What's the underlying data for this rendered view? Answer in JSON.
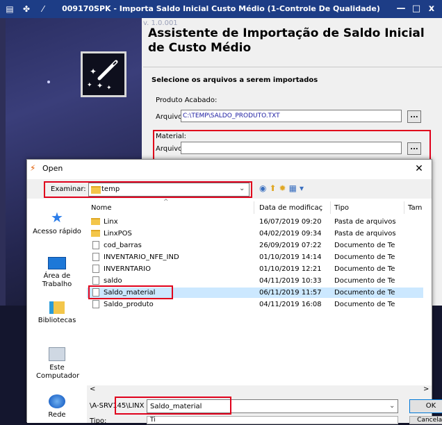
{
  "app": {
    "title": "009170SPK - Importa Saldo Inicial Custo Médio (1-Controle De Qualidade)",
    "window_controls": {
      "minimize": "—",
      "maximize": "□",
      "close": "x"
    },
    "version": "v. 1.0.001",
    "wizard_title": "Assistente de Importação de Saldo Inicial de Custo Médio",
    "select_files_label": "Selecione os arquivos a serem importados",
    "produto_acabado": {
      "group_label": "Produto Acabado:",
      "field_label": "Arquivo:",
      "value": "C:\\TEMP\\SALDO_PRODUTO.TXT",
      "browse_label": "..."
    },
    "material": {
      "group_label": "Material:",
      "field_label": "Arquivo:",
      "value": "",
      "browse_label": "..."
    }
  },
  "dialog": {
    "title": "Open",
    "close_label": "✕",
    "examine_label": "Examinar:",
    "current_folder": "temp",
    "places": [
      {
        "label": "Acesso rápido",
        "icon": "star-icon"
      },
      {
        "label": "Área de Trabalho",
        "icon": "desktop-icon"
      },
      {
        "label": "Bibliotecas",
        "icon": "libraries-icon"
      },
      {
        "label": "Este Computador",
        "icon": "computer-icon"
      },
      {
        "label": "Rede",
        "icon": "network-icon"
      }
    ],
    "columns": [
      "Nome",
      "Data de modificaç",
      "Tipo",
      "Tam"
    ],
    "files": [
      {
        "name": "Linx",
        "date": "16/07/2019 09:20",
        "type": "Pasta de arquivos",
        "kind": "folder"
      },
      {
        "name": "LinxPOS",
        "date": "04/02/2019 09:34",
        "type": "Pasta de arquivos",
        "kind": "folder"
      },
      {
        "name": "cod_barras",
        "date": "26/09/2019 07:22",
        "type": "Documento de Te",
        "kind": "doc"
      },
      {
        "name": "INVENTARIO_NFE_IND",
        "date": "01/10/2019 14:14",
        "type": "Documento de Te",
        "kind": "doc"
      },
      {
        "name": "INVERNTARIO",
        "date": "01/10/2019 12:21",
        "type": "Documento de Te",
        "kind": "doc"
      },
      {
        "name": "saldo",
        "date": "04/11/2019 10:33",
        "type": "Documento de Te",
        "kind": "doc"
      },
      {
        "name": "Saldo_material",
        "date": "06/11/2019 11:57",
        "type": "Documento de Te",
        "kind": "doc",
        "selected": true
      },
      {
        "name": "Saldo_produto",
        "date": "04/11/2019 16:08",
        "type": "Documento de Te",
        "kind": "doc"
      }
    ],
    "path_label": "\\A-SRV145\\LINX",
    "filename_value": "Saldo_material",
    "ok_label": "OK",
    "type_label": "Tipo:",
    "type_value": "Ti",
    "cancel_label": "Cancelar",
    "scroll_left": "<",
    "scroll_right": ">"
  }
}
